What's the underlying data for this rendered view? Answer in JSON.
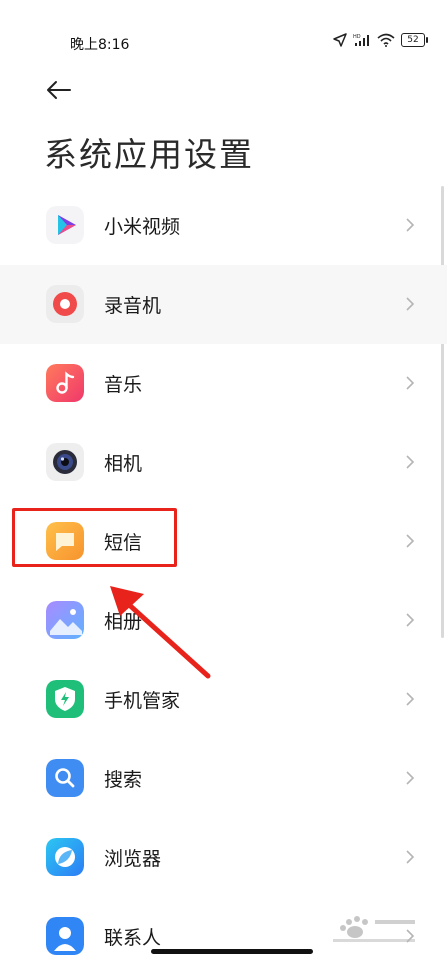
{
  "status_bar": {
    "time": "晚上8:16",
    "battery": "52"
  },
  "header": {
    "title": "系统应用设置"
  },
  "apps": [
    {
      "label": "小米视频"
    },
    {
      "label": "录音机"
    },
    {
      "label": "音乐"
    },
    {
      "label": "相机"
    },
    {
      "label": "短信"
    },
    {
      "label": "相册"
    },
    {
      "label": "手机管家"
    },
    {
      "label": "搜索"
    },
    {
      "label": "浏览器"
    },
    {
      "label": "联系人"
    }
  ],
  "colors": {
    "highlight": "#e8231b",
    "video_icon": "#7b3fe4",
    "recorder_icon": "#f04a4a",
    "music_icon": "#f24f63",
    "camera_icon": "#2a2c3a",
    "sms_icon": "#f8a43a",
    "gallery_icon": "#6e8bff",
    "security_icon": "#1fbf7a",
    "search_icon": "#3f8cf2",
    "browser_icon": "#2c9cf5",
    "contacts_icon": "#2f86f4"
  },
  "icons": [
    "navigation-arrow-icon",
    "hd-signal-icon",
    "wifi-icon",
    "battery-icon",
    "back-arrow-icon",
    "chevron-right-icon"
  ]
}
